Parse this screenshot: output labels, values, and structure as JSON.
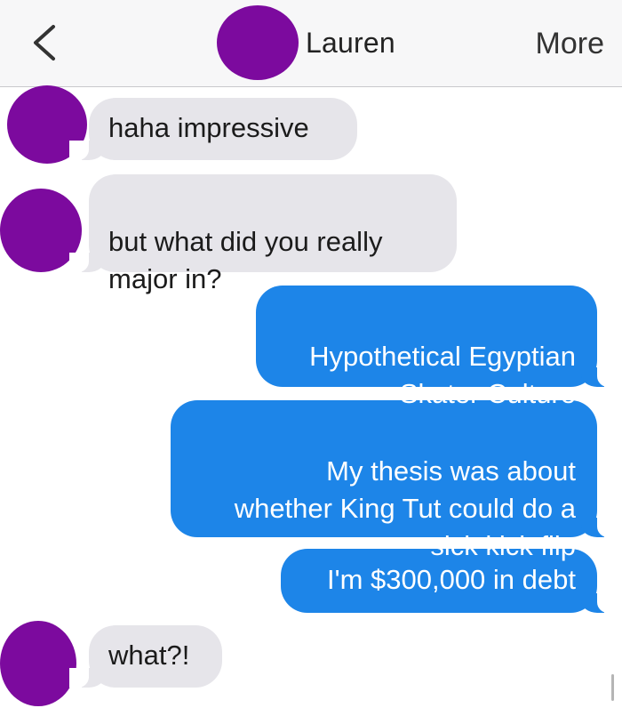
{
  "header": {
    "back_icon": "chevron-left-icon",
    "contact_name": "Lauren",
    "more_label": "More",
    "avatar_color": "#7c0a9e"
  },
  "messages": [
    {
      "direction": "incoming",
      "text": "haha impressive"
    },
    {
      "direction": "incoming",
      "text": "but what did you really\nmajor in?"
    },
    {
      "direction": "outgoing",
      "text": "Hypothetical Egyptian\nSkater Culture"
    },
    {
      "direction": "outgoing",
      "text": "My thesis was about\nwhether King Tut could do a\nsick kick flip"
    },
    {
      "direction": "outgoing",
      "text": "I'm $300,000 in debt"
    },
    {
      "direction": "incoming",
      "text": "what?!"
    }
  ],
  "colors": {
    "incoming_bubble": "#e6e5ea",
    "outgoing_bubble": "#1d85e8",
    "avatar": "#7c0a9e"
  }
}
